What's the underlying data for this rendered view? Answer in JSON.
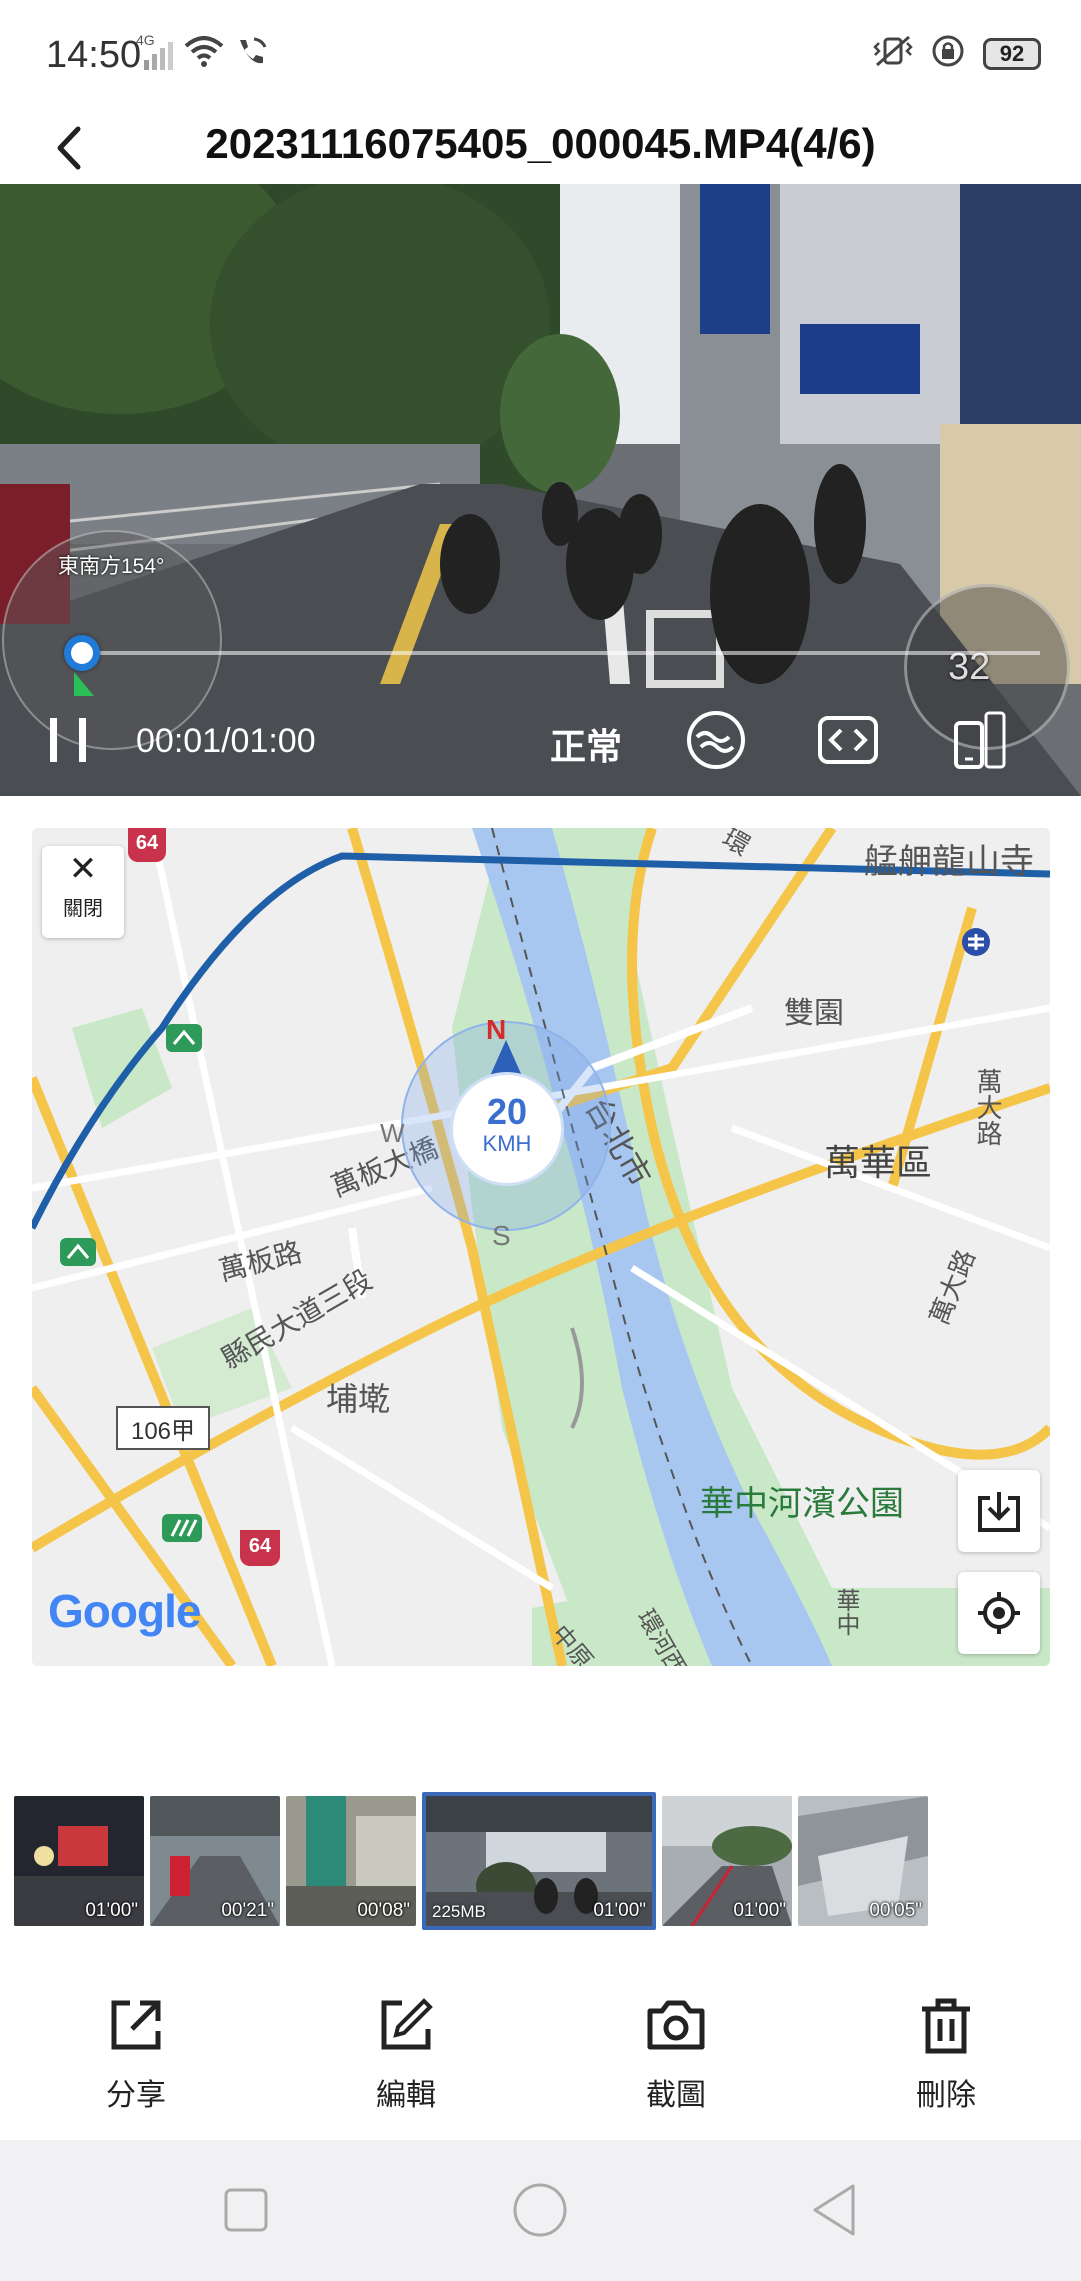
{
  "status_bar": {
    "time": "14:50",
    "network": "4G",
    "battery": "92",
    "icons": [
      "signal-icon",
      "wifi-icon",
      "wifi-calling-icon",
      "vibrate-icon",
      "rotation-lock-icon",
      "battery-icon"
    ]
  },
  "header": {
    "title": "20231116075405_000045.MP4(4/6)",
    "back_icon": "back-arrow-icon"
  },
  "video": {
    "direction_label": "東南方154°",
    "gauge_speed": "32",
    "current_time": "00:01",
    "total_time": "/01:00",
    "progress": 0.017,
    "playback_mode": "正常",
    "icons": [
      "pause-icon",
      "wave-icon",
      "swap-icon",
      "phone-rotate-icon"
    ]
  },
  "map": {
    "close_label": "關閉",
    "speed_value": "20",
    "speed_unit": "KMH",
    "compass_n": "N",
    "compass_s": "S",
    "compass_w": "W",
    "labels": {
      "temple": "艋舺龍山寺",
      "shuangyuan": "雙園",
      "wanhua": "萬華區",
      "wanda_rd_1": "萬大路",
      "wanda_rd_2": "萬大路",
      "taipei_city": "台北市",
      "wanban_bridge": "萬板大橋",
      "wanban_rd": "萬板路",
      "xianmin": "縣民大道三段",
      "puqian": "埔墘",
      "park": "華中河濱公園",
      "huanhe": "環河西",
      "zhongyuan": "中原",
      "huazhong": "華中",
      "route_64_top": "64",
      "route_64_bottom": "64",
      "route_106": "106甲",
      "huan_top": "環"
    },
    "google": "Google",
    "colors": {
      "river": "#a8c7f0",
      "park": "#c9e8c8",
      "road_major": "#f5c54a",
      "route": "#1e5fa8"
    }
  },
  "thumbnails": [
    {
      "duration": "01'00\"",
      "size": ""
    },
    {
      "duration": "00'21\"",
      "size": ""
    },
    {
      "duration": "00'08\"",
      "size": ""
    },
    {
      "duration": "01'00\"",
      "size": "225MB"
    },
    {
      "duration": "01'00\"",
      "size": ""
    },
    {
      "duration": "00'05\"",
      "size": ""
    }
  ],
  "actions": {
    "share": "分享",
    "edit": "編輯",
    "screenshot": "截圖",
    "delete": "刪除"
  }
}
